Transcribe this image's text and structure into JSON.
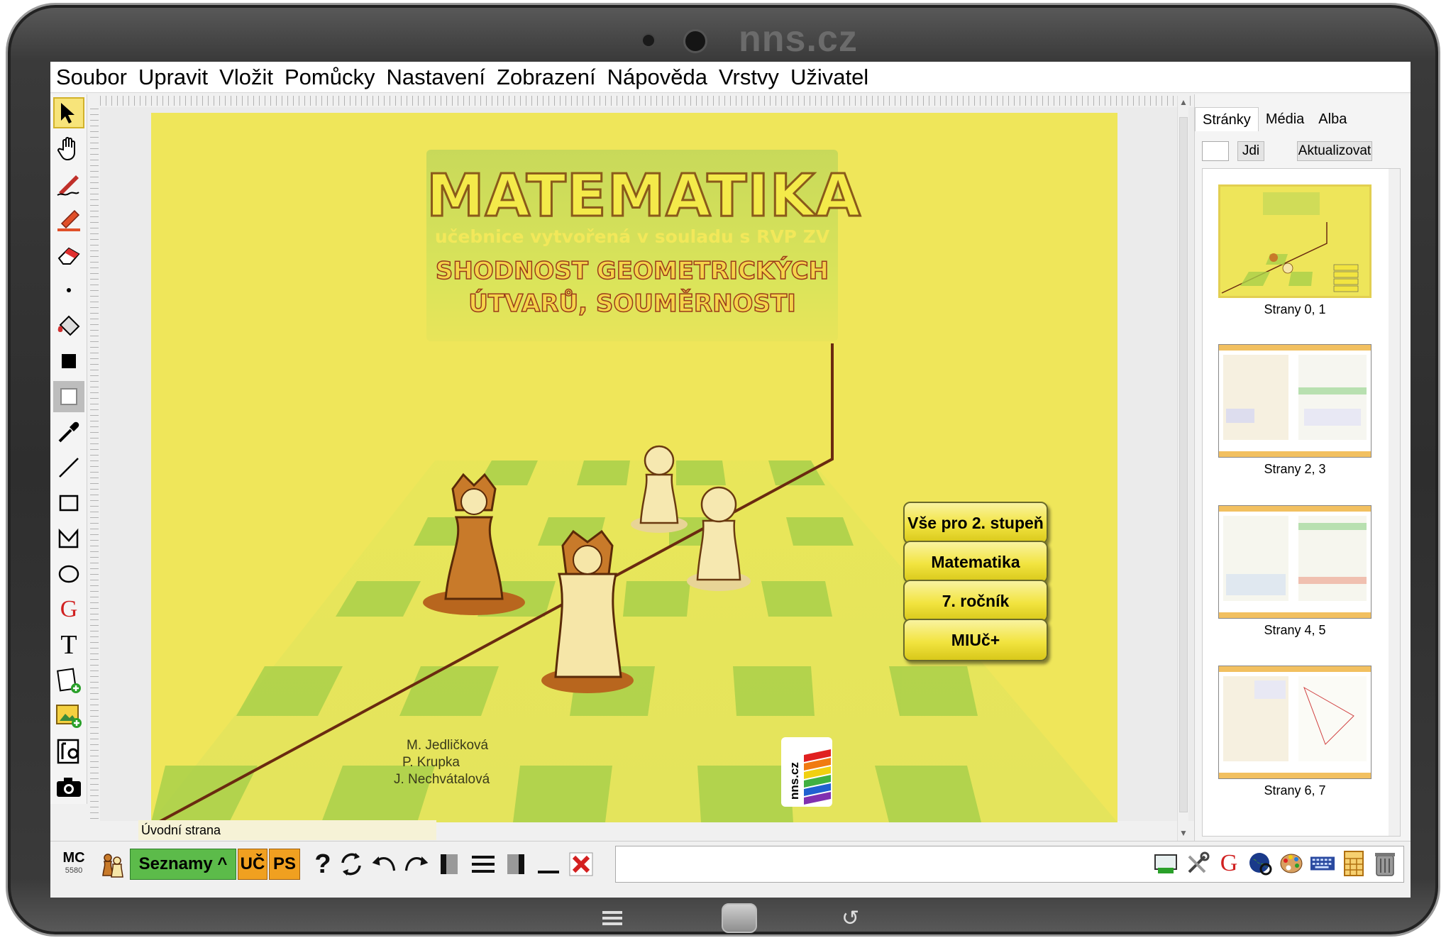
{
  "device": {
    "brand": "nns.cz"
  },
  "menu": [
    "Soubor",
    "Upravit",
    "Vložit",
    "Pomůcky",
    "Nastavení",
    "Zobrazení",
    "Nápověda",
    "Vrstvy",
    "Uživatel"
  ],
  "left_tools": [
    {
      "icon": "select-arrow-icon",
      "selected": true
    },
    {
      "icon": "hand-icon"
    },
    {
      "icon": "pen-icon"
    },
    {
      "icon": "highlighter-icon"
    },
    {
      "icon": "eraser-icon"
    },
    {
      "icon": "dot-icon"
    },
    {
      "icon": "fill-bucket-icon"
    },
    {
      "icon": "fill-color-icon"
    },
    {
      "icon": "outline-color-icon"
    },
    {
      "icon": "eyedropper-icon"
    },
    {
      "icon": "line-icon"
    },
    {
      "icon": "rectangle-icon"
    },
    {
      "icon": "polygon-icon"
    },
    {
      "icon": "ellipse-icon"
    },
    {
      "icon": "geogebra-icon"
    },
    {
      "icon": "text-icon"
    },
    {
      "icon": "add-page-icon"
    },
    {
      "icon": "insert-image-icon"
    },
    {
      "icon": "screen-capture-icon"
    },
    {
      "icon": "camera-icon"
    }
  ],
  "page": {
    "title": "MATEMATIKA",
    "subtitle": "učebnice vytvořená v souladu s RVP ZV",
    "topic_line1": "SHODNOST GEOMETRICKÝCH",
    "topic_line2": "ÚTVARŮ, SOUMĚRNOSTI",
    "authors": [
      "M. Jedličková",
      "P. Krupka",
      "J. Nechvátalová"
    ],
    "logo_text": "nns.cz",
    "buttons": [
      "Vše pro 2. stupeň",
      "Matematika",
      "7. ročník",
      "MIUč+"
    ],
    "label": "Úvodní strana"
  },
  "right_panel": {
    "tabs": [
      "Stránky",
      "Média",
      "Alba"
    ],
    "active_tab": "Stránky",
    "go_label": "Jdi",
    "refresh_label": "Aktualizovat",
    "thumbnails": [
      "Strany 0, 1",
      "Strany 2, 3",
      "Strany 4, 5",
      "Strany 6, 7"
    ]
  },
  "bottom": {
    "mc": "MC",
    "mc_number": "5580",
    "seznamy": "Seznamy ^",
    "uc": "UČ",
    "ps": "PS",
    "help": "?",
    "right_icons": [
      "screen-keyboard-icon",
      "tools-icon",
      "geogebra-icon",
      "globe-icon",
      "palette-icon",
      "keyboard-icon",
      "calculator-icon",
      "trash-icon"
    ]
  },
  "colors": {
    "page_bg": "#efe65a",
    "button_yellow": "#f2e440",
    "seznamy_green": "#5cbb4a",
    "orange": "#f0a020"
  }
}
